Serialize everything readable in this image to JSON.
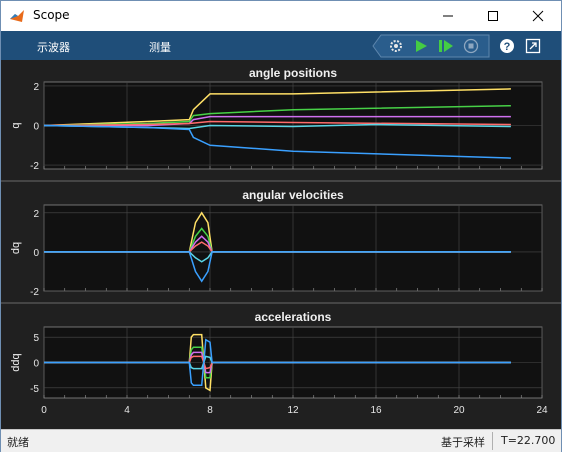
{
  "window": {
    "title": "Scope"
  },
  "toolbar": {
    "tabs": [
      "示波器",
      "测量"
    ],
    "buttons": [
      "settings-gear-icon",
      "run-icon",
      "step-forward-icon",
      "stop-icon",
      "help-icon",
      "undock-icon"
    ]
  },
  "status": {
    "left": "就绪",
    "mode": "基于采样",
    "time": "T=22.700"
  },
  "colors": {
    "background": "#202020",
    "axes": "#111111",
    "grid": "#4a4a4a",
    "toolbar": "#1f4e79",
    "series": [
      "#ffe066",
      "#47d147",
      "#d070f0",
      "#ff6b6b",
      "#5ad6e6",
      "#3aa0ff"
    ]
  },
  "chart_data": [
    {
      "type": "line",
      "title": "angle positions",
      "xlabel": "",
      "ylabel": "q",
      "xlim": [
        0,
        24
      ],
      "ylim": [
        -2.2,
        2.2
      ],
      "yticks": [
        -2,
        0,
        2
      ],
      "series": [
        {
          "color": "#ffe066",
          "x": [
            0,
            5,
            7,
            7.2,
            8,
            12,
            22.5
          ],
          "y": [
            0,
            0.2,
            0.3,
            0.8,
            1.6,
            1.6,
            1.85
          ]
        },
        {
          "color": "#47d147",
          "x": [
            0,
            5,
            7,
            7.2,
            8,
            12,
            22.5
          ],
          "y": [
            0,
            0.1,
            0.2,
            0.5,
            0.6,
            0.8,
            1.0
          ]
        },
        {
          "color": "#d070f0",
          "x": [
            0,
            5,
            7,
            7.2,
            8,
            12,
            22.5
          ],
          "y": [
            0,
            0.0,
            0.1,
            0.3,
            0.45,
            0.45,
            0.45
          ]
        },
        {
          "color": "#ff6b6b",
          "x": [
            0,
            5,
            7,
            8,
            12,
            22.5
          ],
          "y": [
            0,
            0.05,
            0.1,
            0.2,
            0.15,
            0.05
          ]
        },
        {
          "color": "#5ad6e6",
          "x": [
            0,
            5,
            7,
            8,
            12,
            16,
            22.5
          ],
          "y": [
            0,
            -0.1,
            -0.15,
            0.0,
            -0.05,
            0.05,
            -0.05
          ]
        },
        {
          "color": "#3aa0ff",
          "x": [
            0,
            5,
            7,
            7.2,
            8,
            12,
            22.5
          ],
          "y": [
            0,
            -0.1,
            -0.2,
            -0.6,
            -1.0,
            -1.3,
            -1.65
          ]
        }
      ]
    },
    {
      "type": "line",
      "title": "angular velocities",
      "xlabel": "",
      "ylabel": "dq",
      "xlim": [
        0,
        24
      ],
      "ylim": [
        -2,
        2.4
      ],
      "yticks": [
        -2,
        0,
        2
      ],
      "series": [
        {
          "color": "#ffe066",
          "x": [
            0,
            7,
            7.3,
            7.6,
            7.9,
            8.1,
            22.5
          ],
          "y": [
            0,
            0,
            1.5,
            2.0,
            1.5,
            0,
            0
          ]
        },
        {
          "color": "#47d147",
          "x": [
            0,
            7,
            7.3,
            7.6,
            7.9,
            8.1,
            22.5
          ],
          "y": [
            0,
            0,
            0.8,
            1.2,
            0.8,
            0,
            0
          ]
        },
        {
          "color": "#d070f0",
          "x": [
            0,
            7,
            7.3,
            7.6,
            7.9,
            8.1,
            22.5
          ],
          "y": [
            0,
            0,
            0.5,
            0.8,
            0.5,
            0,
            0
          ]
        },
        {
          "color": "#ff6b6b",
          "x": [
            0,
            7,
            7.3,
            7.6,
            7.9,
            8.1,
            22.5
          ],
          "y": [
            0,
            0,
            0.3,
            0.5,
            0.3,
            0,
            0
          ]
        },
        {
          "color": "#5ad6e6",
          "x": [
            0,
            7,
            7.3,
            7.6,
            7.9,
            8.1,
            22.5
          ],
          "y": [
            0,
            0,
            -0.3,
            -0.5,
            -0.3,
            0,
            0
          ]
        },
        {
          "color": "#3aa0ff",
          "x": [
            0,
            7,
            7.3,
            7.6,
            7.9,
            8.1,
            22.5
          ],
          "y": [
            0,
            0,
            -1.0,
            -1.5,
            -1.0,
            0,
            0
          ]
        }
      ]
    },
    {
      "type": "line",
      "title": "accelerations",
      "xlabel": "",
      "ylabel": "ddq",
      "xlim": [
        0,
        24
      ],
      "ylim": [
        -7,
        7
      ],
      "yticks": [
        -5,
        0,
        5
      ],
      "xticks": [
        0,
        4,
        8,
        12,
        16,
        20,
        24
      ],
      "series": [
        {
          "color": "#ffe066",
          "x": [
            0,
            7,
            7.1,
            7.2,
            7.6,
            7.7,
            7.8,
            8.0,
            8.1,
            22.5
          ],
          "y": [
            0,
            0,
            5,
            5.5,
            5.5,
            0,
            -5,
            -5.5,
            0,
            0
          ]
        },
        {
          "color": "#47d147",
          "x": [
            0,
            7,
            7.1,
            7.2,
            7.6,
            7.7,
            7.8,
            8.0,
            8.1,
            22.5
          ],
          "y": [
            0,
            0,
            2.5,
            3,
            3,
            0,
            -3,
            -3,
            0,
            0
          ]
        },
        {
          "color": "#d070f0",
          "x": [
            0,
            7,
            7.1,
            7.2,
            7.6,
            7.7,
            7.8,
            8.0,
            8.1,
            22.5
          ],
          "y": [
            0,
            0,
            1.5,
            2,
            2,
            0,
            -2,
            -2,
            0,
            0
          ]
        },
        {
          "color": "#ff6b6b",
          "x": [
            0,
            7,
            7.1,
            7.2,
            7.6,
            7.7,
            7.8,
            8.0,
            8.1,
            22.5
          ],
          "y": [
            0,
            0,
            1,
            1.2,
            1.2,
            0,
            -1.2,
            -1,
            0,
            0
          ]
        },
        {
          "color": "#5ad6e6",
          "x": [
            0,
            7,
            7.1,
            7.2,
            7.6,
            7.7,
            7.8,
            8.0,
            8.1,
            22.5
          ],
          "y": [
            0,
            0,
            -1,
            -1.2,
            -1.2,
            0,
            1.2,
            1,
            0,
            0
          ]
        },
        {
          "color": "#3aa0ff",
          "x": [
            0,
            7,
            7.1,
            7.2,
            7.6,
            7.7,
            7.8,
            8.0,
            8.1,
            22.5
          ],
          "y": [
            0,
            0,
            -4,
            -4.5,
            -4.5,
            0,
            4.5,
            4,
            0,
            0
          ]
        }
      ]
    }
  ]
}
